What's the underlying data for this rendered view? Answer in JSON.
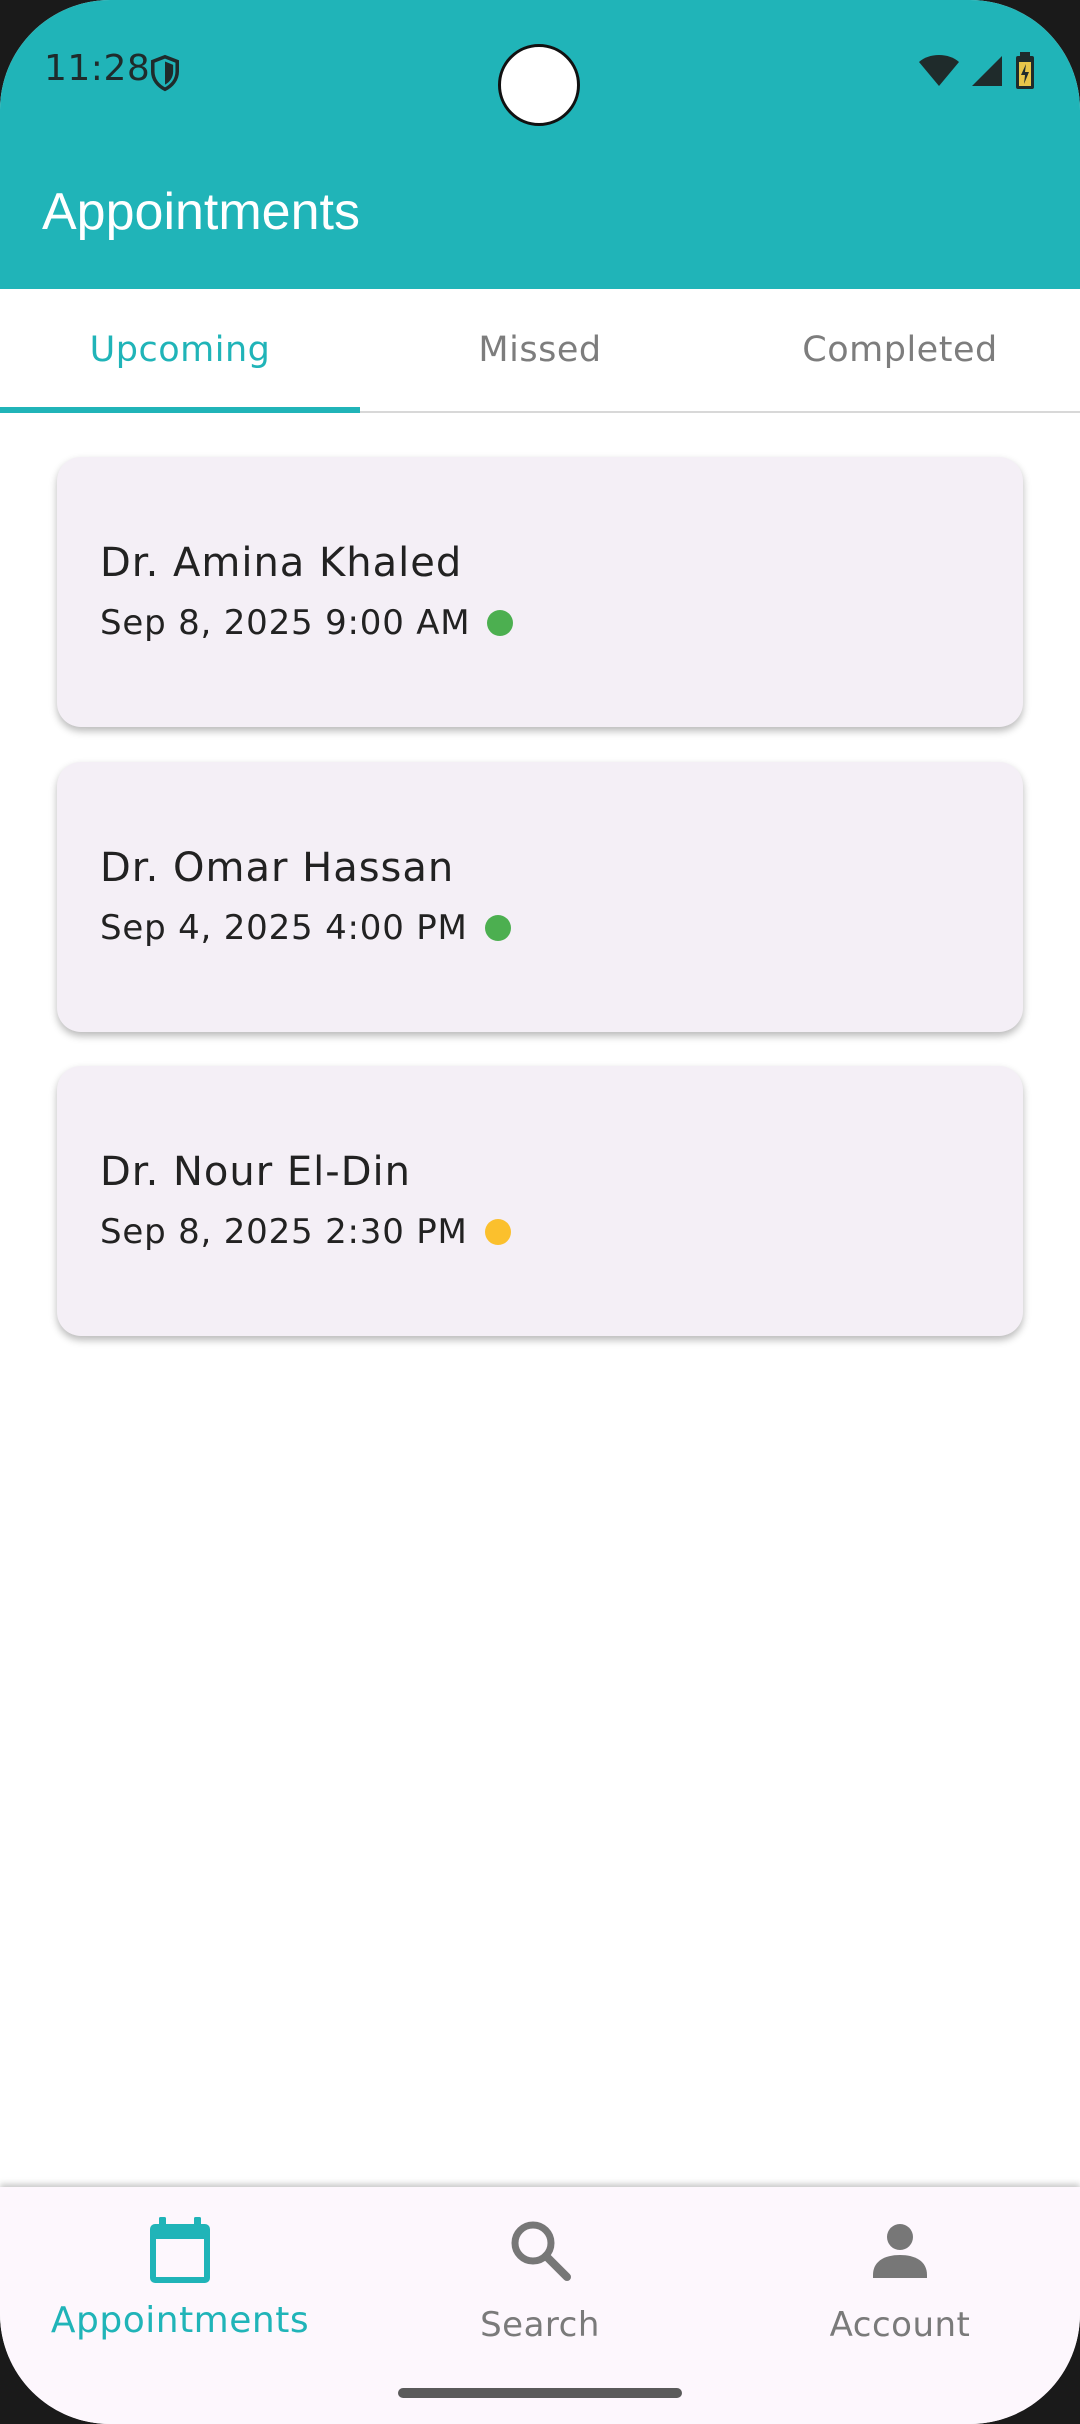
{
  "status_bar": {
    "time": "11:28"
  },
  "app_bar": {
    "title": "Appointments",
    "color": "#20b4b8"
  },
  "tabs": [
    {
      "label": "Upcoming",
      "active": true
    },
    {
      "label": "Missed",
      "active": false
    },
    {
      "label": "Completed",
      "active": false
    }
  ],
  "appointments": [
    {
      "doctor": "Dr. Amina Khaled",
      "datetime": "Sep 8, 2025 9:00 AM",
      "status_color": "#4caf50"
    },
    {
      "doctor": "Dr. Omar Hassan",
      "datetime": "Sep 4, 2025 4:00 PM",
      "status_color": "#4caf50"
    },
    {
      "doctor": "Dr. Nour El-Din",
      "datetime": "Sep 8, 2025 2:30 PM",
      "status_color": "#fbc02d"
    }
  ],
  "bottom_nav": [
    {
      "label": "Appointments",
      "icon": "calendar-icon",
      "active": true
    },
    {
      "label": "Search",
      "icon": "search-icon",
      "active": false
    },
    {
      "label": "Account",
      "icon": "account-icon",
      "active": false
    }
  ]
}
